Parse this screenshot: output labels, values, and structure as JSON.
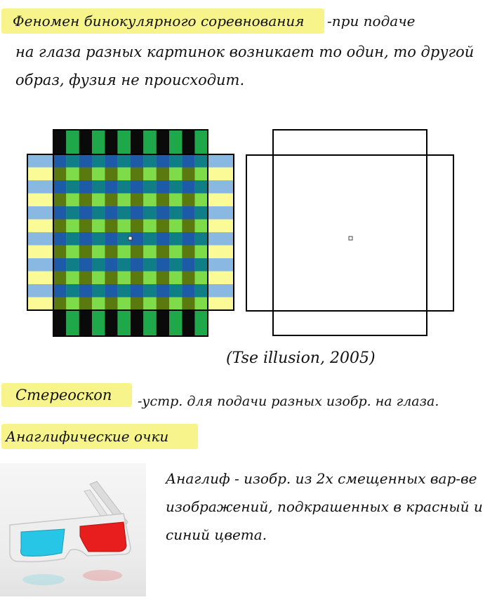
{
  "notes": {
    "line1_highlight": "Феномен бинокулярного соревнования",
    "line1_rest": "-при подаче",
    "line2": "на глаза разных картинок возникает то один, то другой",
    "line3": "образ, фузия не происходит.",
    "citation": "(Tse illusion, 2005)",
    "stereo_term": "Стереоскоп",
    "stereo_def": "-устр. для подачи разных изобр. на глаза.",
    "anaglyph_title": "Анаглифические очки",
    "anaglyph_line1": "Анаглиф - изобр. из 2х смещенных вар-ве",
    "anaglyph_line2": "изображений, подкрашенных в красный и",
    "anaglyph_line3": "синий цвета."
  },
  "colors": {
    "highlight": "#f6f48a",
    "green": "#1ea84a",
    "light_green": "#7edc4a",
    "blue": "#89b8e2",
    "yellow": "#fafa96",
    "teal": "#0f7e86",
    "olive": "#5a7a10",
    "dark_blue": "#1d5aa8",
    "glasses_cyan": "#27c6e6",
    "glasses_red": "#e81e1e"
  }
}
